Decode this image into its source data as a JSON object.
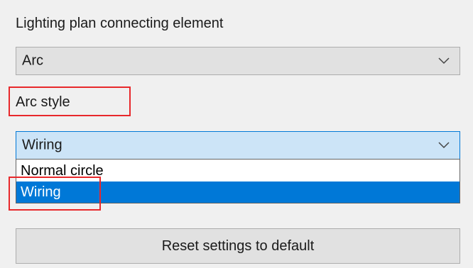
{
  "section": {
    "connecting_element_label": "Lighting plan connecting element",
    "connecting_element_value": "Arc",
    "arc_style_label": "Arc style",
    "arc_style_value": "Wiring",
    "arc_style_options": [
      "Normal circle",
      "Wiring"
    ],
    "arc_style_selected_option": "Wiring",
    "reset_button_label": "Reset settings to default"
  },
  "icons": {
    "combo_arrow": "chevron-down-icon"
  },
  "colors": {
    "selection": "#0078d7",
    "focus_border": "#0078d7",
    "highlight_box": "#e8282b"
  }
}
